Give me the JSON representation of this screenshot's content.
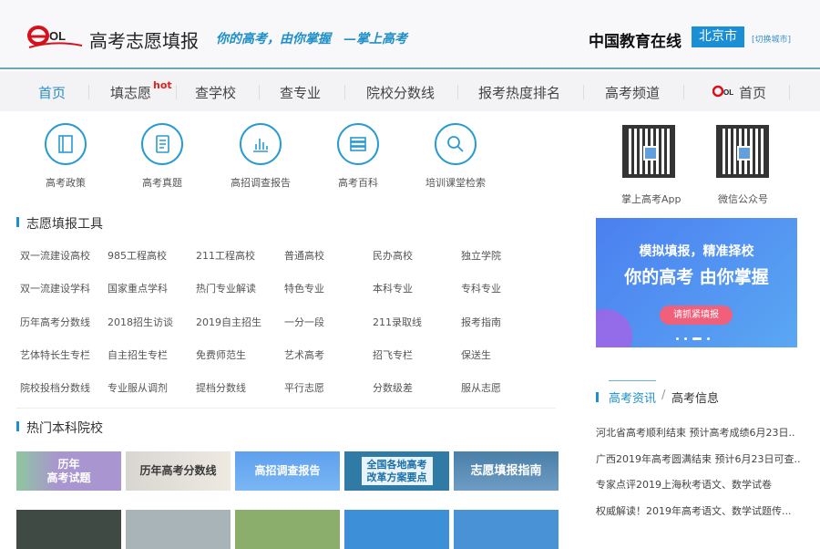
{
  "header": {
    "site_title": "高考志愿填报",
    "slogan": "你的高考，由你掌握　—掌上高考",
    "brand": "中国教育在线",
    "city": "北京市",
    "switch_city": "[切换城市]"
  },
  "nav": {
    "items": [
      "首页",
      "填志愿",
      "查学校",
      "查专业",
      "院校分数线",
      "报考热度排名",
      "高考频道",
      "首页"
    ],
    "hot": "hot"
  },
  "quick_links": [
    "高考政策",
    "高考真题",
    "高招调查报告",
    "高考百科",
    "培训课堂检索"
  ],
  "tools": {
    "title": "志愿填报工具",
    "rows": [
      [
        "双一流建设高校",
        "985工程高校",
        "211工程高校",
        "普通高校",
        "民办高校",
        "独立学院"
      ],
      [
        "双一流建设学科",
        "国家重点学科",
        "热门专业解读",
        "特色专业",
        "本科专业",
        "专科专业"
      ],
      [
        "历年高考分数线",
        "2018招生访谈",
        "2019自主招生",
        "一分一段",
        "211录取线",
        "报考指南"
      ],
      [
        "艺体特长生专栏",
        "自主招生专栏",
        "免费师范生",
        "艺术高考",
        "招飞专栏",
        "保送生"
      ],
      [
        "院校投档分数线",
        "专业服从调剂",
        "提档分数线",
        "平行志愿",
        "分数级差",
        "服从志愿"
      ]
    ]
  },
  "hot_schools": {
    "title": "热门本科院校",
    "banners": [
      "历年\n高考试题",
      "历年高考分数线",
      "高招调查报告",
      "全国各地高考\n改革方案要点",
      "志愿填报指南"
    ]
  },
  "sidebar": {
    "qr": [
      "掌上高考App",
      "微信公众号"
    ],
    "promo": {
      "line1": "模拟填报，精准择校",
      "line2": "你的高考  由你掌握",
      "button": "请抓紧填报"
    },
    "news": {
      "tab_active": "高考资讯",
      "sep": "/",
      "tab_other": "高考信息",
      "items": [
        "河北省高考顺利结束 预计高考成绩6月23日..",
        "广西2019年高考圆满结束 预计6月23日可查..",
        "专家点评2019上海秋考语文、数学试卷",
        "权威解读！2019年高考语文、数学试题传..."
      ]
    }
  },
  "colors": {
    "accent": "#1b8fd6",
    "hot": "#e02020"
  }
}
